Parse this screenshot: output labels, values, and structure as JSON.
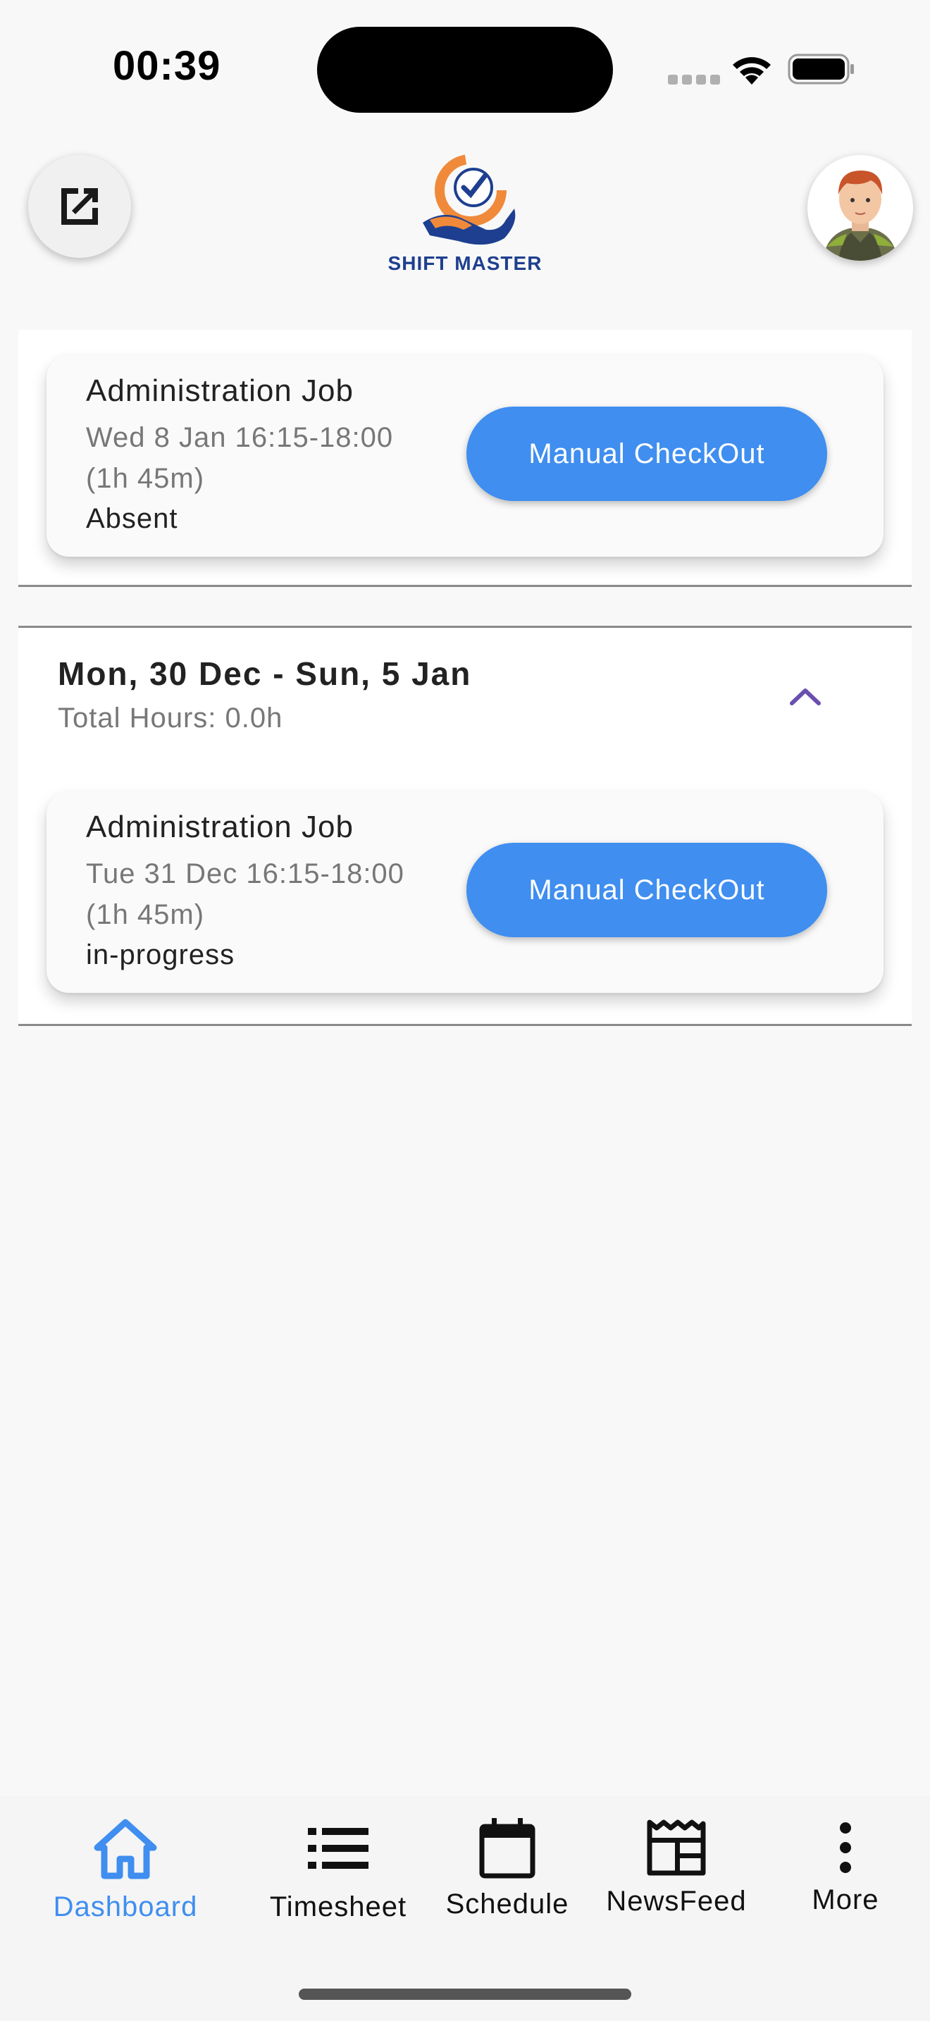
{
  "status_bar": {
    "time": "00:39"
  },
  "header": {
    "open_icon": "open-in-new-icon",
    "logo_text": "SHIFT MASTER",
    "avatar": "user-avatar"
  },
  "current_job": {
    "title": "Administration Job",
    "time_line1": "Wed 8 Jan 16:15-18:00",
    "time_line2": "(1h 45m)",
    "status": "Absent",
    "button_label": "Manual CheckOut"
  },
  "week_group": {
    "range": "Mon, 30 Dec - Sun, 5 Jan",
    "total_hours": "Total Hours: 0.0h",
    "collapse_icon": "chevron-up-icon",
    "jobs": [
      {
        "title": "Administration Job",
        "time_line1": "Tue 31 Dec 16:15-18:00",
        "time_line2": "(1h 45m)",
        "status": "in-progress",
        "button_label": "Manual CheckOut"
      }
    ]
  },
  "bottom_nav": {
    "items": [
      {
        "label": "Dashboard",
        "icon": "home-icon",
        "active": true
      },
      {
        "label": "Timesheet",
        "icon": "list-icon",
        "active": false
      },
      {
        "label": "Schedule",
        "icon": "calendar-icon",
        "active": false
      },
      {
        "label": "NewsFeed",
        "icon": "newspaper-icon",
        "active": false
      },
      {
        "label": "More",
        "icon": "more-vertical-icon",
        "active": false
      }
    ]
  },
  "colors": {
    "accent": "#3f8ef0",
    "logo_blue": "#1e3f8f",
    "logo_orange": "#f08a3a",
    "chevron": "#6a4fb0"
  }
}
